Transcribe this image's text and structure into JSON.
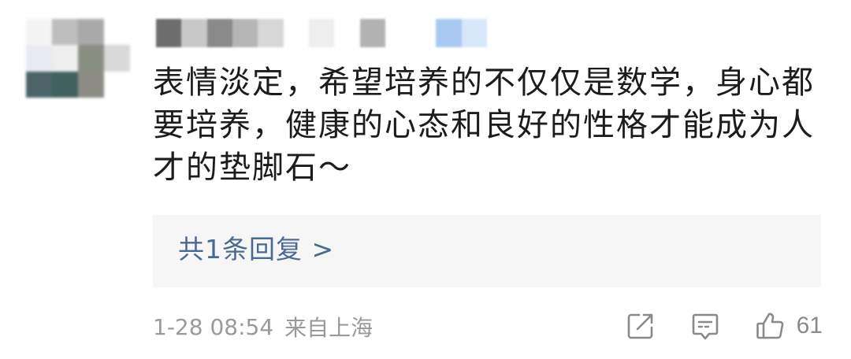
{
  "comment": {
    "text": "表情淡定，希望培养的不仅仅是数学，身心都\n要培养，健康的心态和良好的性格才能成为人\n才的垫脚石～",
    "replies_label": "共1条回复 >",
    "date": "1-28 08:54",
    "location": "来自上海",
    "like_count": "61"
  },
  "icons": {
    "share": "share-out-icon",
    "reply": "comment-bubble-icon",
    "like": "thumbs-up-icon"
  },
  "colors": {
    "text": "#1c1c1c",
    "replies_link": "#4a6a93",
    "meta_gray": "#9a9a9a",
    "replies_bg": "#f6f6f6"
  }
}
